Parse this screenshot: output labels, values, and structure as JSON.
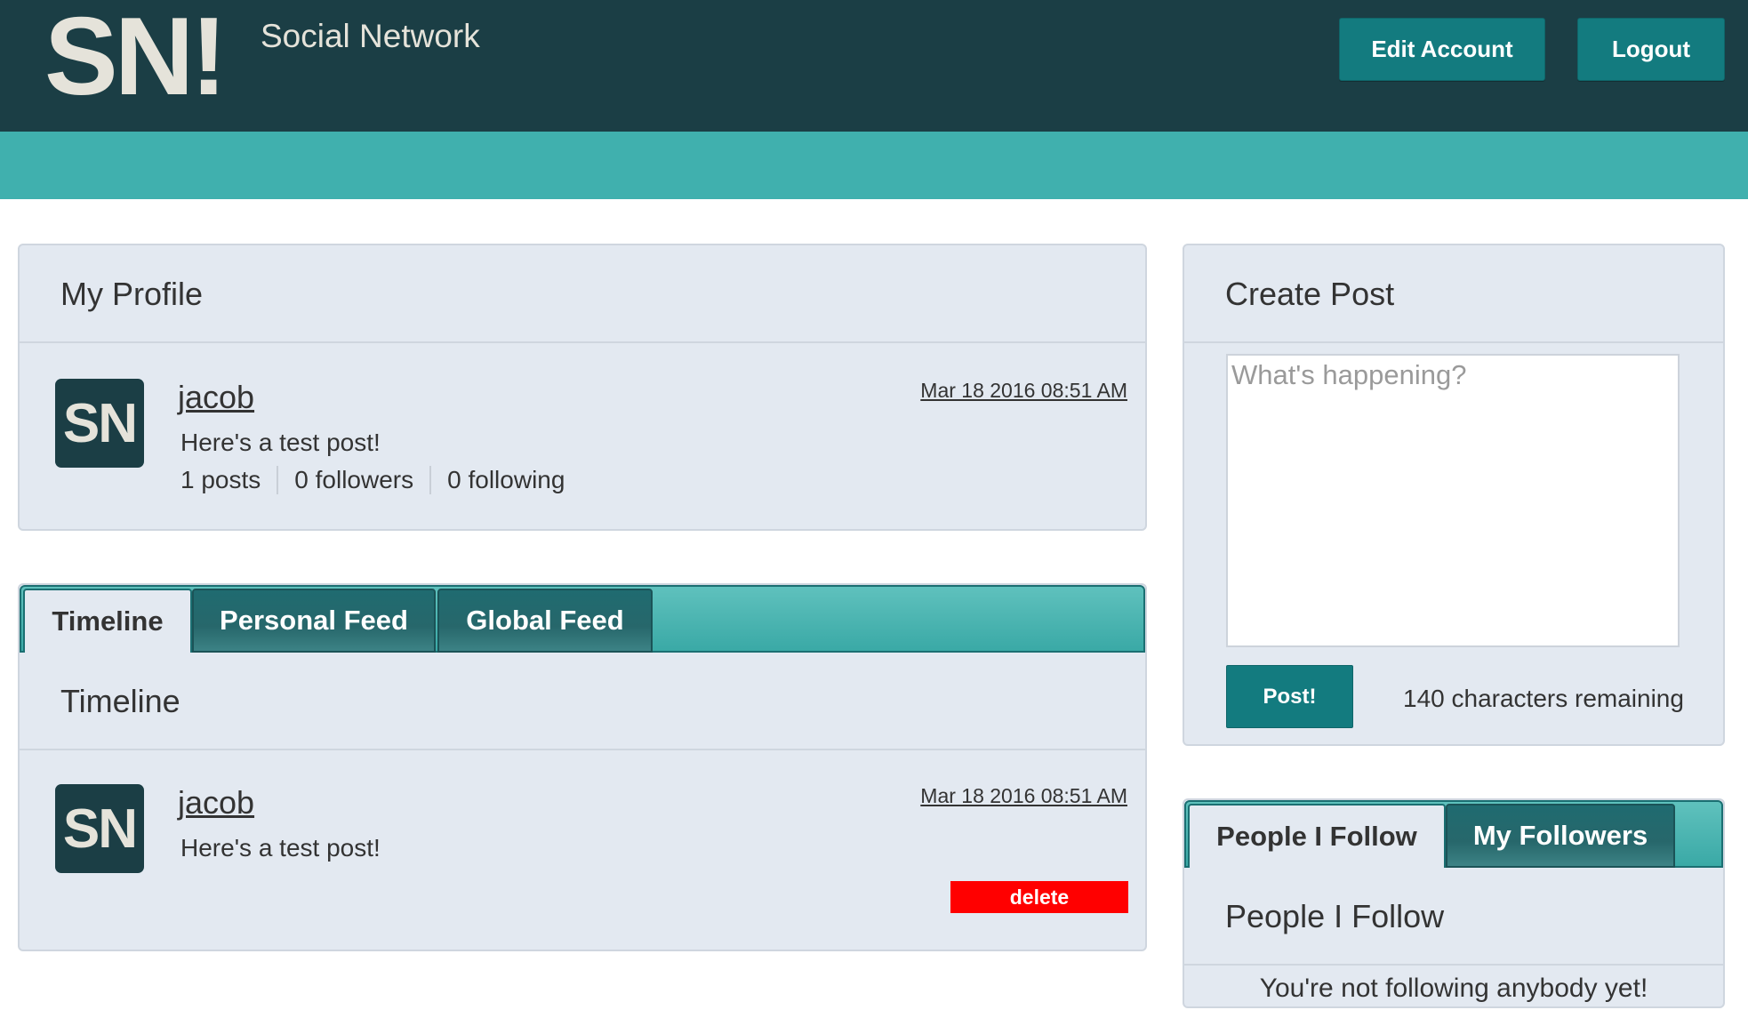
{
  "header": {
    "logo": "SN!",
    "brand_name": "Social Network",
    "edit_account_label": "Edit Account",
    "logout_label": "Logout"
  },
  "profile": {
    "title": "My Profile",
    "avatar_text": "SN",
    "username": "jacob",
    "timestamp": "Mar 18 2016 08:51 AM",
    "latest_post": "Here's a test post!",
    "stats": {
      "posts": "1 posts",
      "followers": "0 followers",
      "following": "0 following"
    }
  },
  "feed": {
    "tabs": [
      {
        "label": "Timeline",
        "active": true
      },
      {
        "label": "Personal Feed",
        "active": false
      },
      {
        "label": "Global Feed",
        "active": false
      }
    ],
    "section_title": "Timeline",
    "posts": [
      {
        "avatar_text": "SN",
        "username": "jacob",
        "timestamp": "Mar 18 2016 08:51 AM",
        "text": "Here's a test post!",
        "delete_label": "delete"
      }
    ]
  },
  "create_post": {
    "title": "Create Post",
    "placeholder": "What's happening?",
    "value": "",
    "submit_label": "Post!",
    "chars_remaining": "140 characters remaining"
  },
  "follow": {
    "tabs": [
      {
        "label": "People I Follow",
        "active": true
      },
      {
        "label": "My Followers",
        "active": false
      }
    ],
    "section_title": "People I Follow",
    "empty_message": "You're not following anybody yet!"
  },
  "colors": {
    "header_bg": "#1b3e45",
    "accent_teal": "#40b0ae",
    "button_teal": "#137b7f",
    "panel_bg": "#e3e9f1",
    "delete_red": "#ff0000"
  }
}
